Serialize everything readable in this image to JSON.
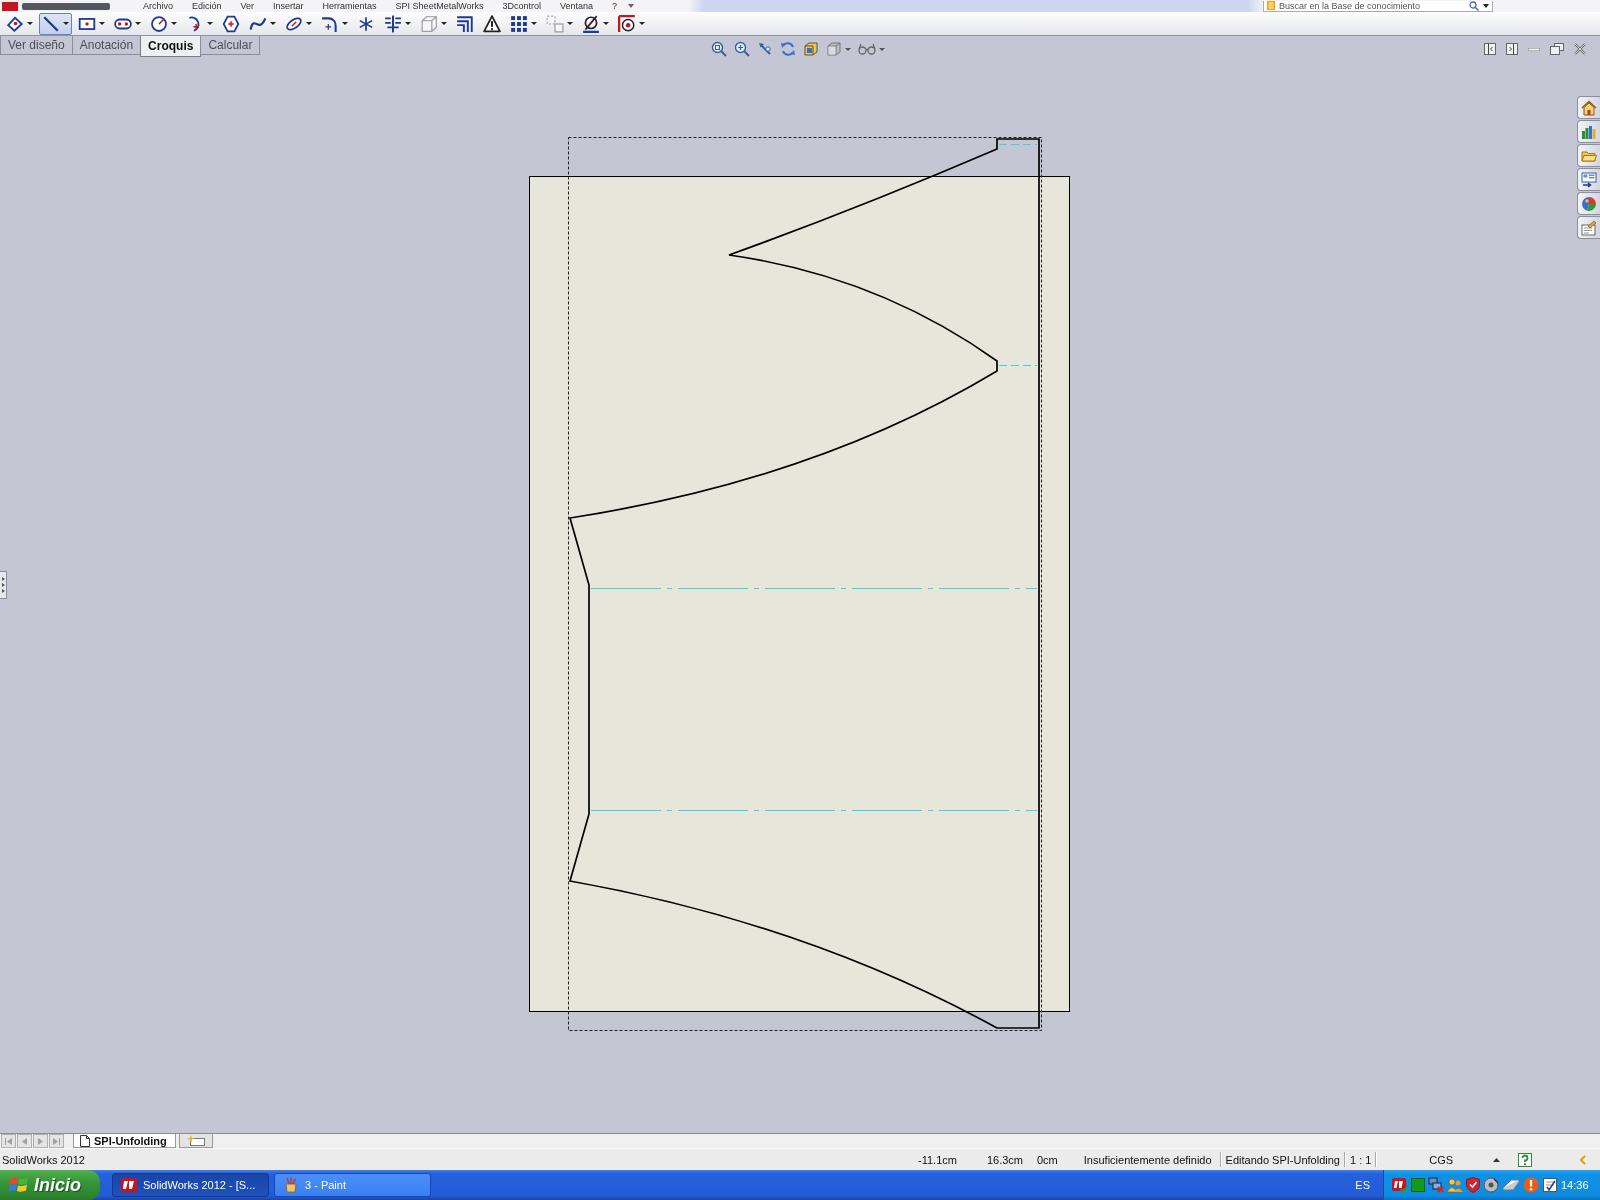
{
  "menu_bar": {
    "items": [
      "Archivo",
      "Edición",
      "Ver",
      "Insertar",
      "Herramientas",
      "SPI SheetMetalWorks",
      "3Dcontrol",
      "Ventana",
      "?"
    ],
    "search": {
      "placeholder": "Buscar en la Base de conocimiento"
    }
  },
  "toolbar": {
    "tools": [
      {
        "kind": "smart_dimension",
        "selected": false,
        "disabled": false,
        "menu": true
      },
      {
        "kind": "line",
        "selected": true,
        "disabled": false,
        "menu": true
      },
      {
        "kind": "rectangle",
        "selected": false,
        "disabled": false,
        "menu": true
      },
      {
        "kind": "slot",
        "selected": false,
        "disabled": false,
        "menu": true
      },
      {
        "kind": "circle",
        "selected": false,
        "disabled": false,
        "menu": true
      },
      {
        "kind": "arc",
        "selected": false,
        "disabled": false,
        "menu": true
      },
      {
        "kind": "polygon",
        "selected": false,
        "disabled": false,
        "menu": false
      },
      {
        "kind": "spline",
        "selected": false,
        "disabled": false,
        "menu": true
      },
      {
        "kind": "ellipse",
        "selected": false,
        "disabled": false,
        "menu": true
      },
      {
        "kind": "fillet",
        "selected": false,
        "disabled": false,
        "menu": true
      },
      {
        "kind": "point",
        "selected": false,
        "disabled": false,
        "menu": false
      },
      {
        "kind": "mirror",
        "selected": false,
        "disabled": false,
        "menu": true
      },
      {
        "kind": "convert",
        "selected": false,
        "disabled": true,
        "menu": true
      },
      {
        "kind": "offset",
        "selected": false,
        "disabled": false,
        "menu": false
      },
      {
        "kind": "relations",
        "selected": false,
        "disabled": false,
        "menu": false
      },
      {
        "kind": "pattern",
        "selected": false,
        "disabled": false,
        "menu": true
      },
      {
        "kind": "move",
        "selected": false,
        "disabled": true,
        "menu": true
      },
      {
        "kind": "repair",
        "selected": false,
        "disabled": false,
        "menu": true
      },
      {
        "kind": "quick_snaps",
        "selected": false,
        "disabled": false,
        "menu": true
      }
    ]
  },
  "command_tabs": [
    {
      "label": "Ver diseño",
      "selected": false
    },
    {
      "label": "Anotación",
      "selected": false
    },
    {
      "label": "Croquis",
      "selected": true
    },
    {
      "label": "Calcular",
      "selected": false
    }
  ],
  "sheet_tabs": [
    {
      "label": "SPI-Unfolding",
      "selected": true
    }
  ],
  "status_bar": {
    "app": "SolidWorks 2012",
    "x": "-11.1cm",
    "y": "16.3cm",
    "z": "0cm",
    "sketch_state": "Insuficientemente definido",
    "editing": "Editando SPI-Unfolding",
    "scale": "1 : 1",
    "units": "CGS"
  },
  "taskbar": {
    "start": "Inicio",
    "tasks": [
      {
        "kind": "solidworks",
        "label": "SolidWorks 2012 - [S...",
        "selected": true
      },
      {
        "kind": "paint",
        "label": "3 - Paint",
        "selected": false
      }
    ],
    "language": "ES",
    "clock": "14:36"
  }
}
